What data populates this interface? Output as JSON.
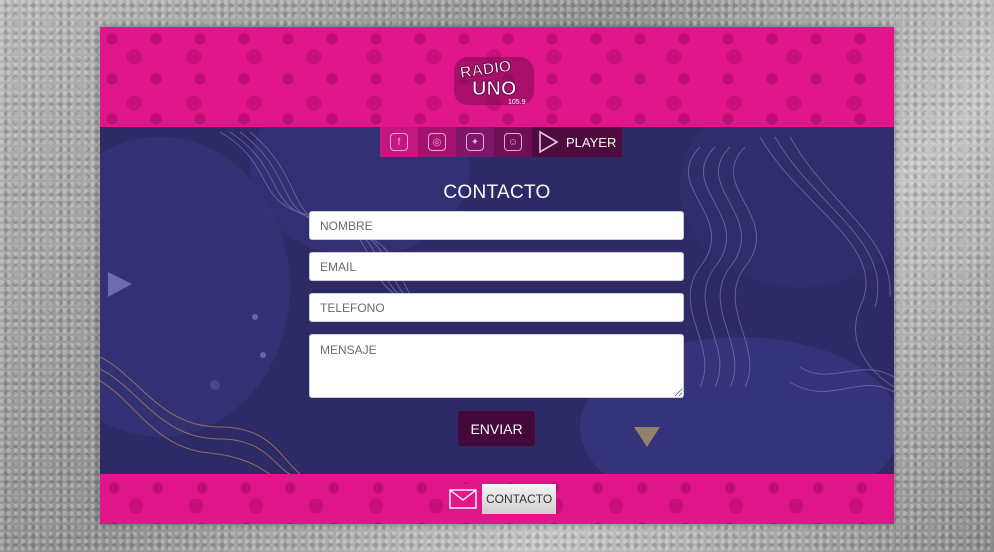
{
  "brand": {
    "logo_line1": "RADIO",
    "logo_line2": "UNO",
    "frequency": "105.9",
    "primary_color": "#e0168a",
    "dark_color": "#2e2a66"
  },
  "nav": {
    "social": [
      {
        "icon": "facebook-icon",
        "glyph": "f"
      },
      {
        "icon": "instagram-icon",
        "glyph": "◎"
      },
      {
        "icon": "twitter-icon",
        "glyph": "✦"
      },
      {
        "icon": "snapchat-icon",
        "glyph": "☺"
      }
    ],
    "player_label": "PLAYER"
  },
  "form": {
    "title": "CONTACTO",
    "name_placeholder": "NOMBRE",
    "email_placeholder": "EMAIL",
    "phone_placeholder": "TELEFONO",
    "message_placeholder": "MENSAJE",
    "submit_label": "ENVIAR"
  },
  "footer": {
    "contact_label": "CONTACTO"
  }
}
